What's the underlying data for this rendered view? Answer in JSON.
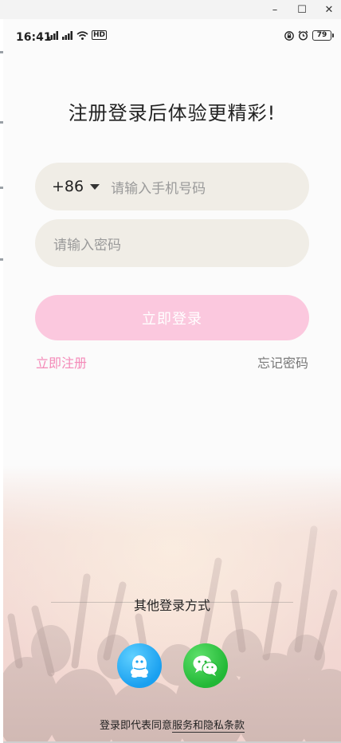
{
  "window": {
    "minimize_glyph": "–",
    "maximize_glyph": "☐",
    "close_glyph": "✕"
  },
  "status_bar": {
    "time": "16:41",
    "hd_label": "HD",
    "battery_level": "79"
  },
  "login": {
    "title": "注册登录后体验更精彩!",
    "country_code": "+86",
    "phone_placeholder": "请输入手机号码",
    "password_placeholder": "请输入密码",
    "login_button": "立即登录",
    "register_link": "立即注册",
    "forgot_link": "忘记密码",
    "other_login_label": "其他登录方式",
    "agreement_prefix": "登录即代表同意",
    "agreement_link": "服务和隐私条款"
  },
  "colors": {
    "accent_pink": "#f48ab8",
    "login_button_bg": "#fbc8de",
    "input_bg": "#f0ede6",
    "qq_blue": "#1aa0f0",
    "wechat_green": "#22b836"
  },
  "icons": [
    "qq-icon",
    "wechat-icon",
    "signal-icon",
    "wifi-icon",
    "lock-icon",
    "alarm-icon",
    "battery-icon",
    "dropdown-caret-icon"
  ]
}
